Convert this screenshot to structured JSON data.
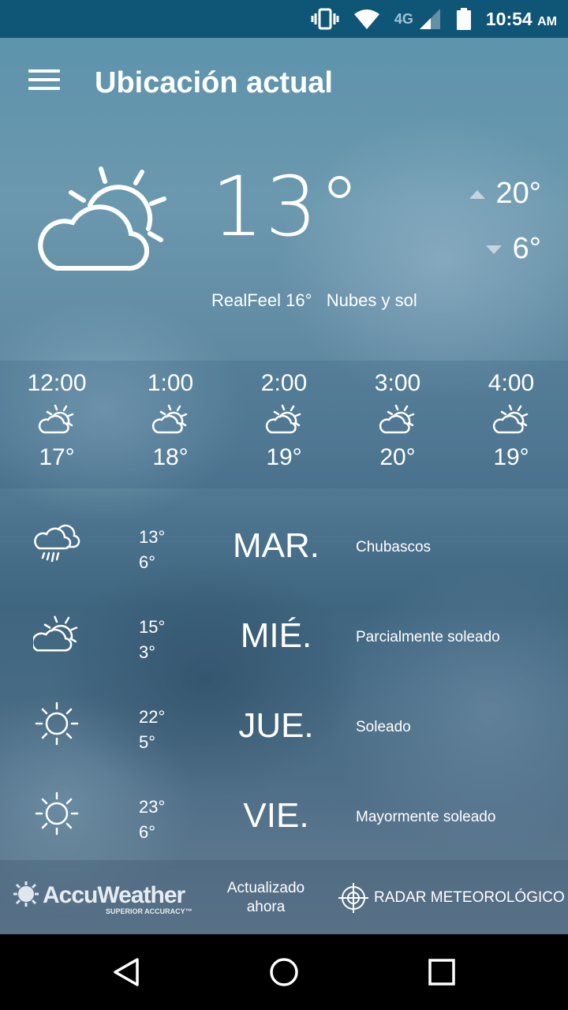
{
  "status_bar": {
    "network": "4G",
    "time": "10:54",
    "ampm": "AM"
  },
  "header": {
    "title": "Ubicación actual"
  },
  "current": {
    "temp": "13°",
    "high": "20°",
    "low": "6°",
    "realfeel": "RealFeel 16°",
    "condition": "Nubes y sol"
  },
  "hourly": [
    {
      "time": "12:00",
      "temp": "17°",
      "icon": "partly-sunny-icon"
    },
    {
      "time": "1:00",
      "temp": "18°",
      "icon": "partly-sunny-icon"
    },
    {
      "time": "2:00",
      "temp": "19°",
      "icon": "partly-sunny-icon"
    },
    {
      "time": "3:00",
      "temp": "20°",
      "icon": "partly-sunny-icon"
    },
    {
      "time": "4:00",
      "temp": "19°",
      "icon": "partly-sunny-icon"
    }
  ],
  "daily": [
    {
      "high": "13°",
      "low": "6°",
      "day": "MAR.",
      "condition": "Chubascos",
      "icon": "rain-cloud-icon"
    },
    {
      "high": "15°",
      "low": "3°",
      "day": "MIÉ.",
      "condition": "Parcialmente soleado",
      "icon": "partly-sunny-icon"
    },
    {
      "high": "22°",
      "low": "5°",
      "day": "JUE.",
      "condition": "Soleado",
      "icon": "sun-icon"
    },
    {
      "high": "23°",
      "low": "6°",
      "day": "VIE.",
      "condition": "Mayormente soleado",
      "icon": "sun-icon"
    }
  ],
  "footer": {
    "logo": "AccuWeather",
    "logo_sub": "SUPERIOR ACCURACY™",
    "updated": "Actualizado ahora",
    "radar": "RADAR METEOROLÓGICO"
  },
  "colors": {
    "status_bar": "#0f5576",
    "text": "#ffffff"
  }
}
